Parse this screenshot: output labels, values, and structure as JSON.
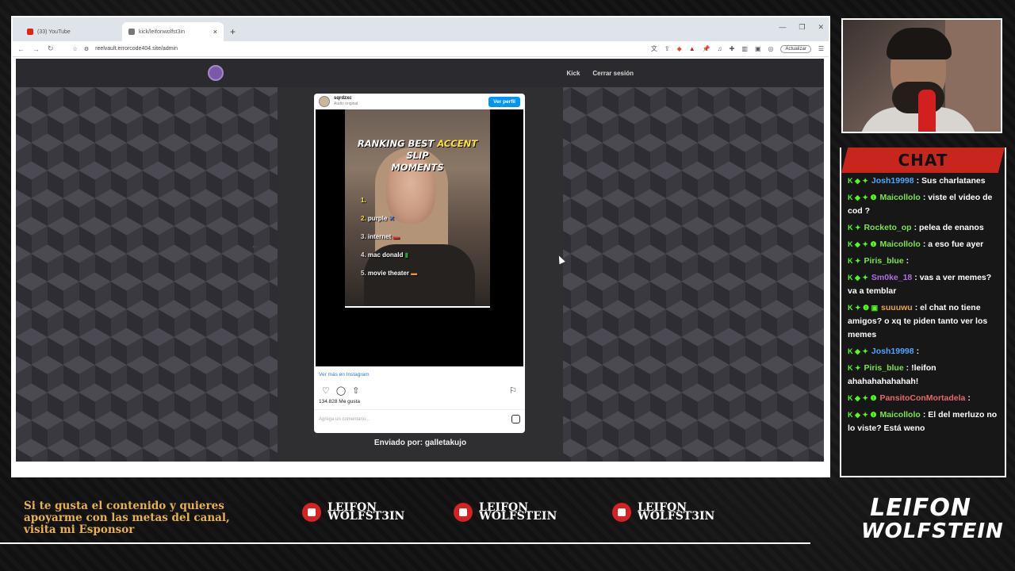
{
  "browser": {
    "tabs": [
      {
        "label": "(33) YouTube",
        "favicon_color": "#e62117"
      },
      {
        "label": "kick/leifonwolfst3in",
        "favicon_color": "#777777"
      }
    ],
    "new_tab": "+",
    "url": "reelvault.errorcode404.site/admin",
    "update_button": "Actualizar"
  },
  "page": {
    "nav": {
      "kick": "Kick",
      "logout": "Cerrar sesión"
    },
    "instagram": {
      "username": "sqrdzxc",
      "audio": "Audio original",
      "view_profile": "Ver perfil",
      "video_title_1": "RANKING BEST ",
      "video_title_hl": "ACCENT",
      "video_title_2": " SLIP",
      "video_title_3": "MOMENTS",
      "ranks": [
        {
          "n": "1.",
          "label": ""
        },
        {
          "n": "2.",
          "label": "purple"
        },
        {
          "n": "3.",
          "label": "internet"
        },
        {
          "n": "4.",
          "label": "mac donald"
        },
        {
          "n": "5.",
          "label": "movie theater"
        }
      ],
      "see_more": "Ver más en Instagram",
      "likes": "134.828 Me gusta",
      "comment_placeholder": "Agrega un comentario..."
    },
    "sent_by": "Enviado por: galletakujo",
    "arrow_left": "←",
    "arrow_right": "→"
  },
  "chat": {
    "title": "CHAT",
    "messages": [
      {
        "badges": "K ◆ ✦",
        "name": "Josh19998",
        "color": "#4aa8ff",
        "text": ": Sus charlatanes"
      },
      {
        "badges": "K ◆ ✦ ❶",
        "name": "Maicollolo",
        "color": "#7ee34a",
        "text": ": viste el video de cod ?"
      },
      {
        "badges": "K ✦",
        "name": "Rocketo_op",
        "color": "#7ee34a",
        "text": ": pelea de enanos"
      },
      {
        "badges": "K ◆ ✦ ❶",
        "name": "Maicollolo",
        "color": "#7ee34a",
        "text": ": a eso fue ayer"
      },
      {
        "badges": "K ✦",
        "name": "Piris_blue",
        "color": "#7ee34a",
        "text": ":"
      },
      {
        "badges": "K ◆ ✦",
        "name": "Sm0ke_18",
        "color": "#b070e0",
        "text": ": vas a ver memes? va a temblar"
      },
      {
        "badges": "K ✦ ❶ ▣",
        "name": "suuuwu",
        "color": "#e8a84a",
        "text": ": el chat no tiene amigos? o xq te piden tanto ver los memes"
      },
      {
        "badges": "K ◆ ✦",
        "name": "Josh19998",
        "color": "#4aa8ff",
        "text": ":"
      },
      {
        "badges": "K ✦",
        "name": "Piris_blue",
        "color": "#7ee34a",
        "text": ": !leifon ahahahahahahah!"
      },
      {
        "badges": "K ◆ ✦ ❶",
        "name": "PansitoConMortadela",
        "color": "#e86a6a",
        "text": ":"
      },
      {
        "badges": "K ◆ ✦ ❶",
        "name": "Maicollolo",
        "color": "#7ee34a",
        "text": ": El del merluzo no lo viste? Está weno"
      }
    ]
  },
  "footer": {
    "sponsor_text": "Si te gusta el contenido y quieres apoyarme con las metas del canal, visita mi Esponsor",
    "socials": [
      {
        "icon": "youtube-icon",
        "line1": "LEIFON",
        "line2": "WOLFST3IN"
      },
      {
        "icon": "instagram-icon",
        "line1": "LEIFON",
        "line2": "WOLFSTEIN"
      },
      {
        "icon": "tiktok-icon",
        "line1": "LEIFON",
        "line2": "WOLFST3IN"
      }
    ],
    "brand_line1": "LEIFON",
    "brand_line2": "WOLFSTEIN"
  }
}
